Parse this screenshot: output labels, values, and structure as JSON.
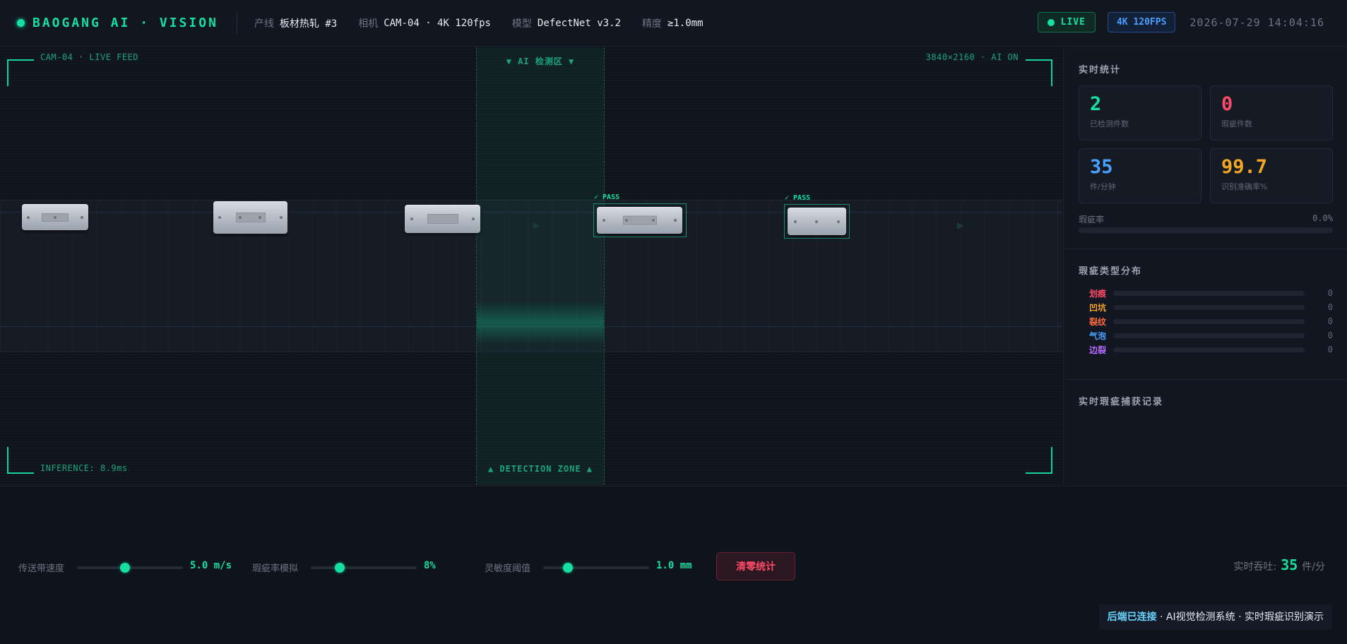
{
  "header": {
    "brand": "BAOGANG AI · VISION",
    "line_label": "产线",
    "line_value": "板材热轧 #3",
    "camera_label": "相机",
    "camera_value": "CAM-04 · 4K 120fps",
    "model_label": "模型",
    "model_value": "DefectNet v3.2",
    "precision_label": "精度",
    "precision_value": "≥1.0mm",
    "live_badge": "LIVE",
    "resolution_badge": "4K 120FPS",
    "datetime": "2026-07-29 14:04:16",
    "colors": {
      "accent": "#15e0a0",
      "blue": "#4aa0ff"
    }
  },
  "feed": {
    "top_left": "CAM-04 · LIVE FEED",
    "top_right": "3840×2160 · AI ON",
    "bottom_left": "INFERENCE: 8.9ms",
    "zone_top": "▼ AI 检测区 ▼",
    "zone_bottom": "▲ DETECTION ZONE ▲",
    "pass_tag_1": "✓ PASS",
    "pass_tag_2": "✓ PASS"
  },
  "stats": {
    "title": "实时统计",
    "detected_value": "2",
    "detected_label": "已检测件数",
    "defect_value": "0",
    "defect_label": "瑕疵件数",
    "rate_value": "35",
    "rate_label": "件/分钟",
    "accuracy_value": "99.7",
    "accuracy_label": "识别准确率%",
    "defect_rate_label": "瑕疵率",
    "defect_rate_value": "0.0%",
    "defect_rate_fraction": 0.0,
    "colors": {
      "detected": "#15e0a0",
      "defect": "#ff4a68",
      "rate": "#4aa0ff",
      "accuracy": "#f5a623"
    }
  },
  "distribution": {
    "title": "瑕疵类型分布",
    "items": [
      {
        "name": "划痕",
        "count": "0",
        "color": "#ff4a68"
      },
      {
        "name": "凹坑",
        "count": "0",
        "color": "#f5a623"
      },
      {
        "name": "裂纹",
        "count": "0",
        "color": "#ff6b3d"
      },
      {
        "name": "气泡",
        "count": "0",
        "color": "#4aa0ff"
      },
      {
        "name": "边裂",
        "count": "0",
        "color": "#b56cff"
      }
    ]
  },
  "captures": {
    "title": "实时瑕疵捕获记录"
  },
  "controls": {
    "speed_label": "传送带速度",
    "speed_value": "5.0 m/s",
    "speed_fraction": 0.45,
    "defect_sim_label": "瑕疵率模拟",
    "defect_sim_value": "8%",
    "defect_sim_fraction": 0.27,
    "sensitivity_label": "灵敏度阈值",
    "sensitivity_value": "1.0 mm",
    "sensitivity_fraction": 0.23,
    "reset_label": "清零统计",
    "throughput_label": "实时吞吐:",
    "throughput_value": "35",
    "throughput_unit": "件/分"
  },
  "toast": {
    "status": "后端已连接",
    "message": " · AI视觉检测系统 · 实时瑕疵识别演示"
  }
}
